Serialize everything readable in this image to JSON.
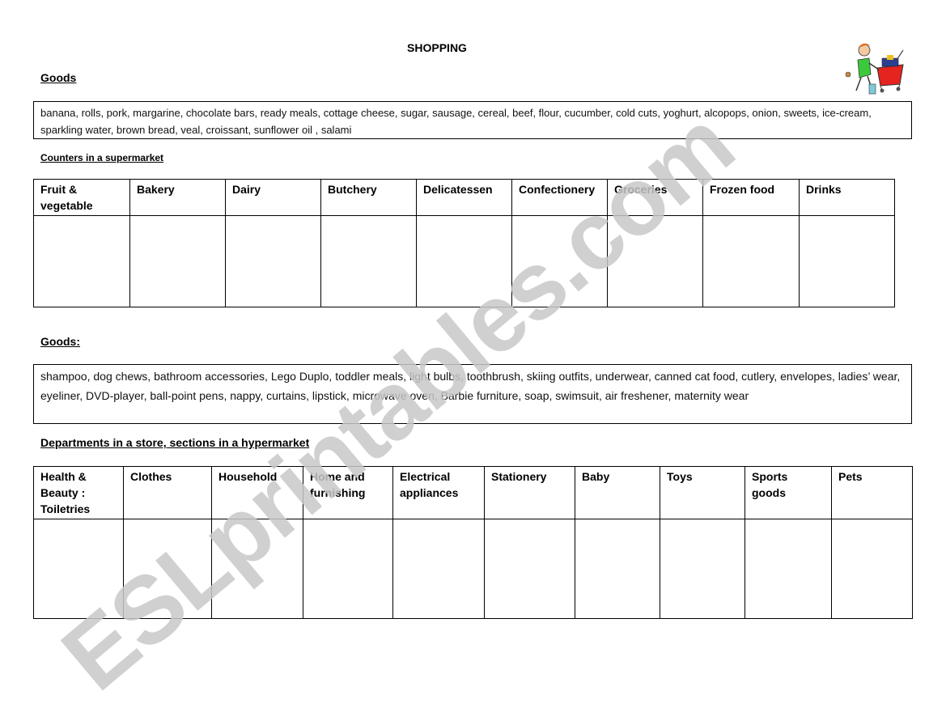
{
  "title": "SHOPPING",
  "section1": {
    "heading": "Goods",
    "goods": "banana,  rolls,  pork,  margarine,   chocolate bars, ready meals,  cottage cheese, sugar, sausage, cereal, beef, flour, cucumber,  cold cuts,   yoghurt,   alcopops,   onion, sweets, ice-cream, sparkling water, brown bread,  veal, croissant, sunflower oil , salami",
    "table_heading": "Counters in a supermarket",
    "columns": [
      "Fruit & vegetable",
      "Bakery",
      "Dairy",
      "Butchery",
      "Delicatessen",
      "Confectionery",
      "Groceries",
      "Frozen food",
      "Drinks"
    ]
  },
  "section2": {
    "heading": "Goods:",
    "goods": "shampoo, dog chews, bathroom accessories, Lego Duplo, toddler meals, light bulbs, toothbrush, skiing outfits, underwear, canned cat food, cutlery, envelopes, ladies’ wear, eyeliner, DVD-player, ball-point pens, nappy, curtains, lipstick, microwave oven, Barbie furniture, soap, swimsuit, air freshener, maternity wear",
    "table_heading": "Departments in a store, sections in a hypermarket",
    "columns": [
      "Health & Beauty : Toiletries",
      "Clothes",
      "Household",
      "Home and furnishing",
      "Electrical appliances",
      "Stationery",
      "Baby",
      "Toys",
      "Sports goods",
      "Pets"
    ]
  },
  "watermark": "ESLprintables.com",
  "clipart": "shopper-with-cart-clipart"
}
